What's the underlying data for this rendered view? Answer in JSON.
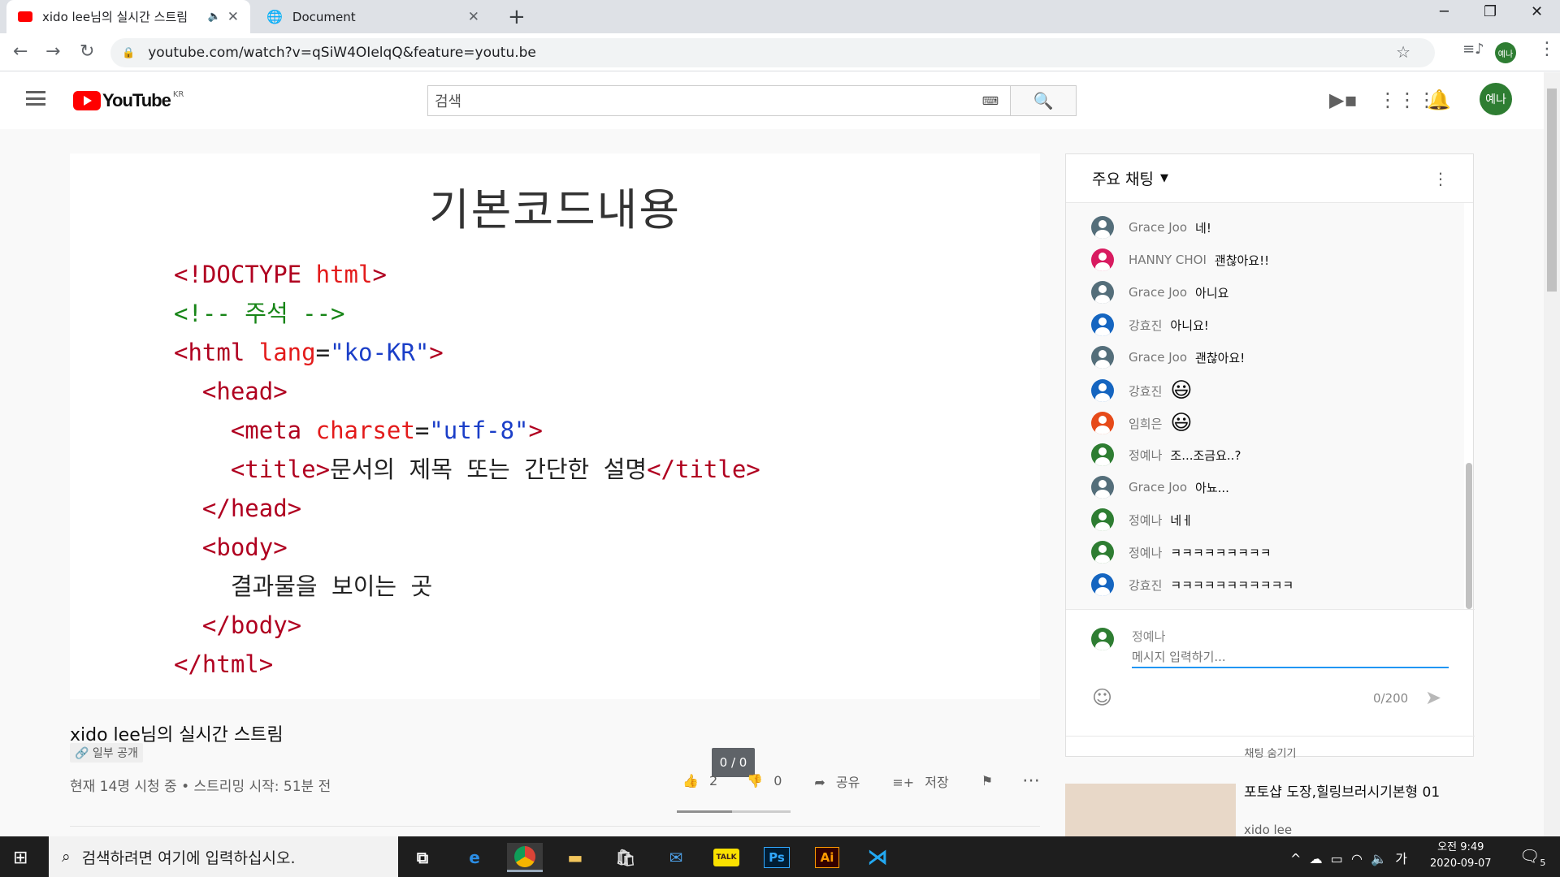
{
  "browser": {
    "tabs": [
      {
        "title": "xido lee님의 실시간 스트림",
        "favicon": "youtube-icon",
        "audio": "speaker-icon"
      },
      {
        "title": "Document",
        "favicon": "globe-icon"
      }
    ],
    "url": "youtube.com/watch?v=qSiW4OIelqQ&feature=youtu.be",
    "profile_initials": "예나"
  },
  "youtube": {
    "logo_text": "YouTube",
    "region": "KR",
    "search_placeholder": "검색",
    "avatar_text": "예나"
  },
  "slide": {
    "title": "기본코드내용",
    "code_lines": [
      [
        {
          "t": "<!DOCTYPE ",
          "c": "t"
        },
        {
          "t": "html",
          "c": "a"
        },
        {
          "t": ">",
          "c": "t"
        }
      ],
      [
        {
          "t": "<!-- 주석 -->",
          "c": "c"
        }
      ],
      [
        {
          "t": "<html ",
          "c": "t"
        },
        {
          "t": "lang",
          "c": "a"
        },
        {
          "t": "=",
          "c": "k"
        },
        {
          "t": "\"ko-KR\"",
          "c": "v"
        },
        {
          "t": ">",
          "c": "t"
        }
      ],
      [
        {
          "t": "  <head>",
          "c": "t"
        }
      ],
      [
        {
          "t": "    <meta ",
          "c": "t"
        },
        {
          "t": "charset",
          "c": "a"
        },
        {
          "t": "=",
          "c": "k"
        },
        {
          "t": "\"utf-8\"",
          "c": "v"
        },
        {
          "t": ">",
          "c": "t"
        }
      ],
      [
        {
          "t": "    <title>",
          "c": "t"
        },
        {
          "t": "문서의 제목 또는 간단한 설명",
          "c": "k"
        },
        {
          "t": "</title>",
          "c": "t"
        }
      ],
      [
        {
          "t": "  </head>",
          "c": "t"
        }
      ],
      [
        {
          "t": "  <body>",
          "c": "t"
        }
      ],
      [
        {
          "t": "    결과물을 보이는 곳",
          "c": "k"
        }
      ],
      [
        {
          "t": "  </body>",
          "c": "t"
        }
      ],
      [
        {
          "t": "</html>",
          "c": "t"
        }
      ]
    ]
  },
  "video": {
    "title": "xido lee님의 실시간 스트림",
    "visibility": "일부 공개",
    "stats": "현재 14명 시청 중 • 스트리밍 시작: 51분 전",
    "likes": "2",
    "dislikes": "0",
    "share_label": "공유",
    "save_label": "저장",
    "tooltip": "0 / 0"
  },
  "chat": {
    "header": "주요 채팅",
    "messages": [
      {
        "author": "Grace Joo",
        "text": "네!",
        "color": "#546e7a"
      },
      {
        "author": "HANNY CHOI",
        "text": "괜찮아요!!",
        "color": "#d81b60"
      },
      {
        "author": "Grace Joo",
        "text": "아니요",
        "color": "#546e7a"
      },
      {
        "author": "강효진",
        "text": "아니요!",
        "color": "#1565c0"
      },
      {
        "author": "Grace Joo",
        "text": "괜찮아요!",
        "color": "#546e7a"
      },
      {
        "author": "강효진",
        "text": "😃",
        "color": "#1565c0"
      },
      {
        "author": "임희은",
        "text": "😃",
        "color": "#e64a19"
      },
      {
        "author": "정예나",
        "text": "조...조금요..?",
        "color": "#2e7d32"
      },
      {
        "author": "Grace Joo",
        "text": "아뇨...",
        "color": "#546e7a"
      },
      {
        "author": "정예나",
        "text": "네ㅔ",
        "color": "#2e7d32"
      },
      {
        "author": "정예나",
        "text": "ㅋㅋㅋㅋㅋㅋㅋㅋㅋ",
        "color": "#2e7d32"
      },
      {
        "author": "강효진",
        "text": "ㅋㅋㅋㅋㅋㅋㅋㅋㅋㅋㅋ",
        "color": "#1565c0"
      }
    ],
    "input_author": "정예나",
    "input_placeholder": "메시지 입력하기...",
    "char_count": "0/200",
    "hide_label": "채팅 숨기기"
  },
  "recommendation": {
    "title": "포토샵 도장,힐링브러시기본형 01",
    "author": "xido lee"
  },
  "taskbar": {
    "search_placeholder": "검색하려면 여기에 입력하십시오.",
    "ime": "가",
    "time": "오전 9:49",
    "date": "2020-09-07",
    "notifications": "5"
  }
}
